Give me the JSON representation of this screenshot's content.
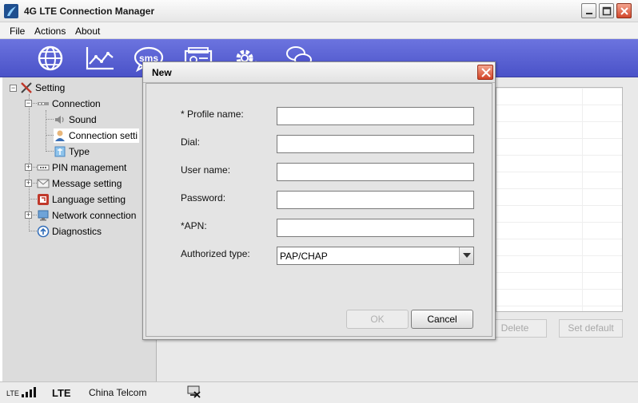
{
  "window": {
    "title": "4G LTE Connection Manager"
  },
  "menu": {
    "file": "File",
    "actions": "Actions",
    "about": "About"
  },
  "toolbar": {
    "items": [
      {
        "icon": "globe-icon"
      },
      {
        "icon": "statistics-icon"
      },
      {
        "icon": "sms-icon",
        "label": "sms"
      },
      {
        "icon": "contacts-icon"
      },
      {
        "icon": "settings-icon"
      },
      {
        "icon": "chat-icon"
      }
    ]
  },
  "tree": {
    "setting": "Setting",
    "connection": "Connection",
    "sound": "Sound",
    "connection_settings": "Connection setti",
    "type": "Type",
    "pin_management": "PIN management",
    "message_setting": "Message setting",
    "language_setting": "Language setting",
    "network_connection": "Network connection",
    "diagnostics": "Diagnostics"
  },
  "background_buttons": {
    "delete": "Delete",
    "set_default": "Set default"
  },
  "dialog": {
    "title": "New",
    "fields": {
      "profile_name": {
        "label": "* Profile name:",
        "value": ""
      },
      "dial": {
        "label": "Dial:",
        "value": ""
      },
      "user_name": {
        "label": "User name:",
        "value": ""
      },
      "password": {
        "label": "Password:",
        "value": ""
      },
      "apn": {
        "label": "*APN:",
        "value": ""
      },
      "authorized_type": {
        "label": "Authorized type:",
        "value": "PAP/CHAP"
      }
    },
    "ok": "OK",
    "cancel": "Cancel"
  },
  "status": {
    "network_type": "LTE",
    "operator": "China Telcom",
    "signal_label": "LTE"
  },
  "colors": {
    "toolbar": "#5a61d2",
    "panel": "#dcdcdc",
    "close": "#d24427"
  }
}
